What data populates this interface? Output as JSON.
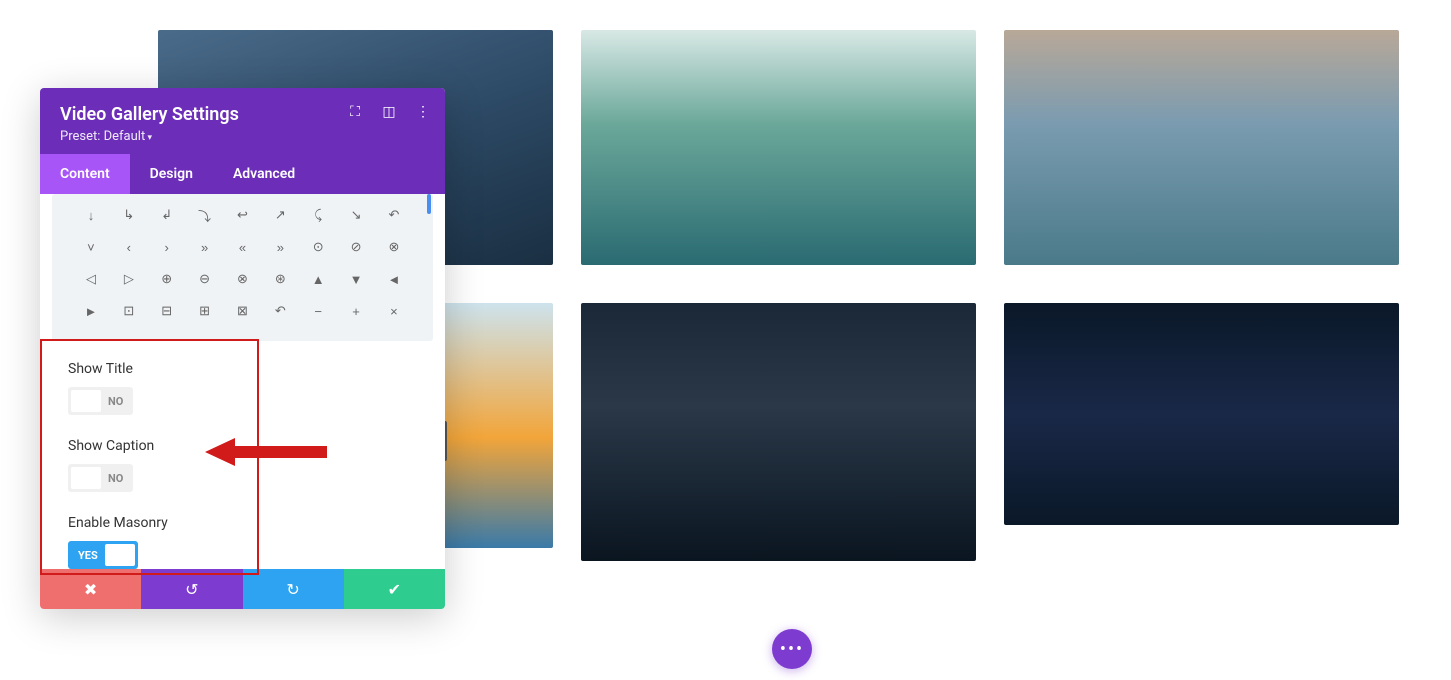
{
  "panel": {
    "title": "Video Gallery Settings",
    "preset": "Preset: Default"
  },
  "tabs": {
    "content": "Content",
    "design": "Design",
    "advanced": "Advanced"
  },
  "options": {
    "show_title": {
      "label": "Show Title",
      "value_text": "NO"
    },
    "show_caption": {
      "label": "Show Caption",
      "value_text": "NO"
    },
    "enable_masonry": {
      "label": "Enable Masonry",
      "value_text": "YES"
    }
  },
  "icon_rows": [
    [
      "↓",
      "↳",
      "↲",
      "⤵",
      "↩",
      "↗",
      "⤹",
      "↘",
      "↶"
    ],
    [
      "˅",
      "‹",
      "›",
      "»",
      "«",
      "»",
      "⊙",
      "⊘",
      "⊗"
    ],
    [
      "◁",
      "▷",
      "⊕",
      "⊖",
      "⊗",
      "⊛",
      "▲",
      "▼",
      "◄"
    ],
    [
      "►",
      "⊡",
      "⊟",
      "⊞",
      "⊠",
      "↶",
      "−",
      "+",
      "×"
    ]
  ],
  "fab": "•••"
}
